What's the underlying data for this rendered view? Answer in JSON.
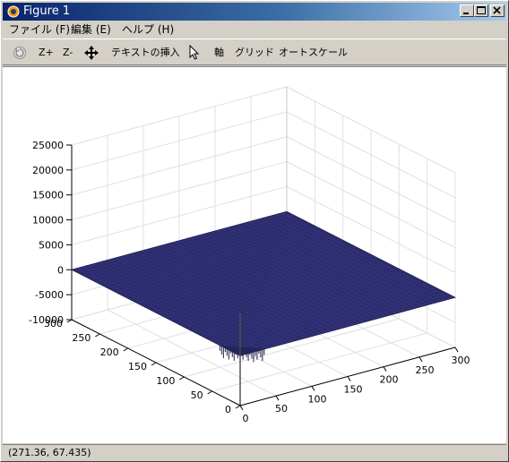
{
  "window": {
    "title": "Figure 1"
  },
  "menu": {
    "items": [
      "ファイル (F)",
      "編集 (E)",
      "ヘルプ (H)"
    ]
  },
  "toolbar": {
    "zoom_in": "Z+",
    "zoom_out": "Z-",
    "insert_text": "テキストの挿入",
    "axis": "軸",
    "grid": "グリッド",
    "autoscale": "オートスケール"
  },
  "chart_data": {
    "type": "surface",
    "z_ticks": [
      "25000",
      "20000",
      "15000",
      "10000",
      "5000",
      "0",
      "-5000",
      "-10000"
    ],
    "y_ticks": [
      "300",
      "250",
      "200",
      "150",
      "100",
      "50",
      "0"
    ],
    "x_ticks": [
      "0",
      "50",
      "100",
      "150",
      "200",
      "250",
      "300"
    ],
    "xlim": [
      0,
      300
    ],
    "ylim": [
      0,
      300
    ],
    "zlim": [
      -10000,
      25000
    ],
    "grid": true,
    "surface_color": "#2e2e72",
    "surface_level": 0,
    "spike": {
      "z_min": -10000,
      "z_max": 8500
    }
  },
  "statusbar": {
    "coords": "(271.36, 67.435)"
  }
}
